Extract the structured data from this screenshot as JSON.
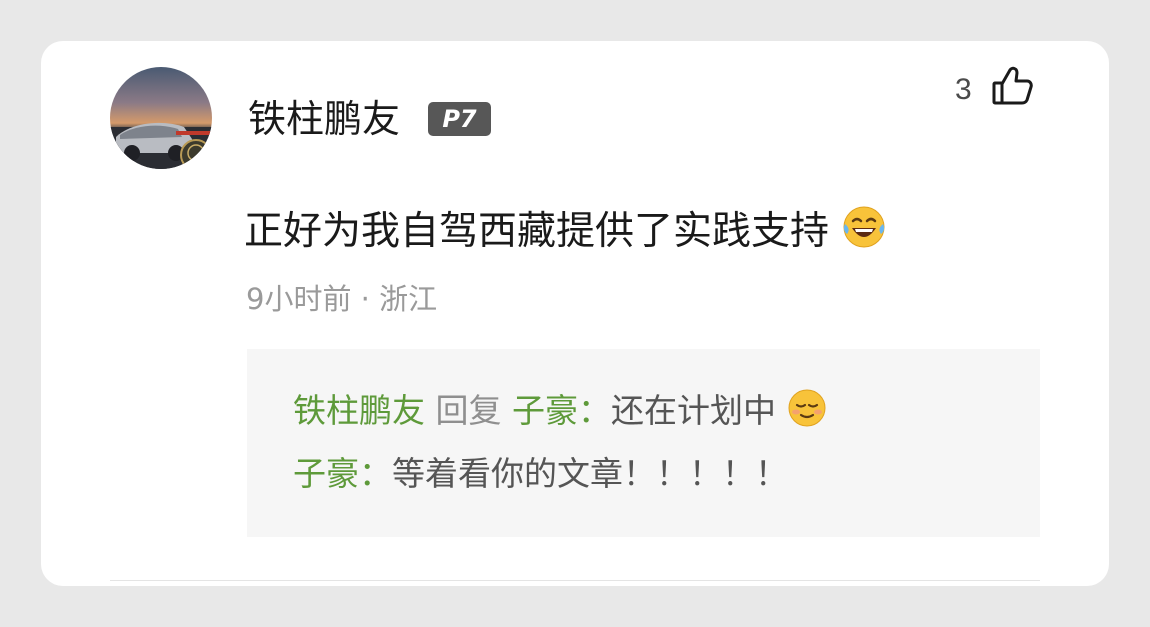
{
  "comment": {
    "username": "铁柱鹏友",
    "level_badge": "P7",
    "like_count": "3",
    "like_icon": "thumbs-up-outline-icon",
    "text": "正好为我自驾西藏提供了实践支持",
    "text_emoji": "laughing-tears-emoji",
    "time": "9小时前",
    "separator": "·",
    "location": "浙江"
  },
  "replies": [
    {
      "author": "铁柱鹏友",
      "action": "回复",
      "target": "子豪：",
      "text": "还在计划中",
      "emoji": "relieved-face-emoji"
    },
    {
      "author": "子豪：",
      "text": "等着看你的文章！！！！！"
    }
  ],
  "colors": {
    "username_green": "#5e9a3a",
    "badge_bg": "#575757",
    "meta_gray": "#9a9a9a",
    "reply_bg": "#f6f6f6"
  }
}
